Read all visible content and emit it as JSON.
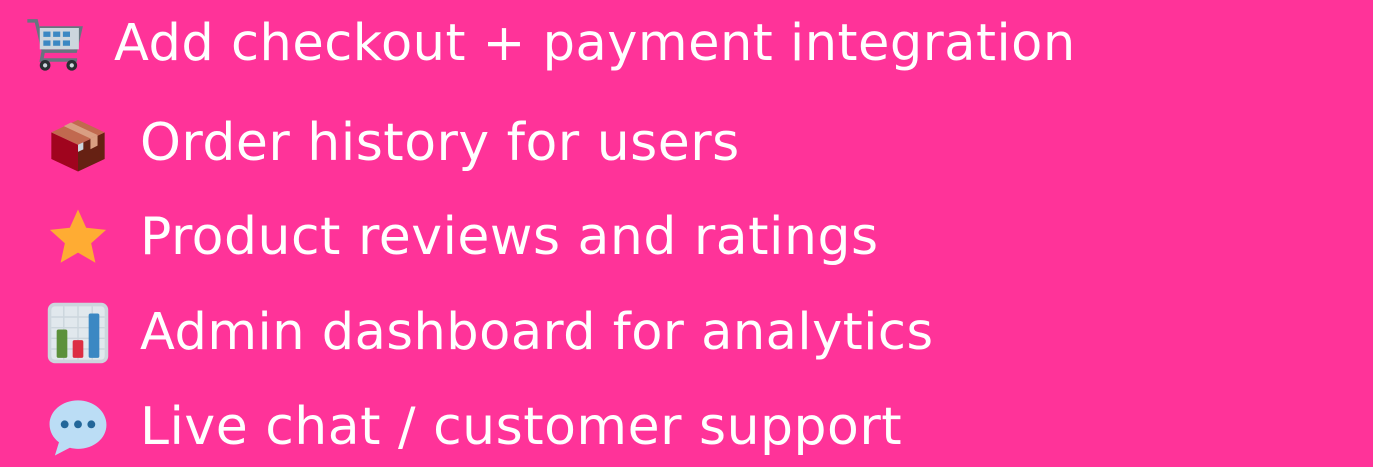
{
  "features": {
    "items": [
      {
        "icon": "shopping-cart-icon",
        "label": "Add checkout + payment integration"
      },
      {
        "icon": "package-icon",
        "label": "Order history for users"
      },
      {
        "icon": "star-icon",
        "label": "Product reviews and ratings"
      },
      {
        "icon": "bar-chart-icon",
        "label": "Admin dashboard for analytics"
      },
      {
        "icon": "speech-balloon-icon",
        "label": "Live chat / customer support"
      }
    ]
  },
  "colors": {
    "background": "#ff3399",
    "text": "#ffffff",
    "star": "#ffac33",
    "chart_green": "#5c913b",
    "chart_red": "#dd2e44",
    "chart_blue": "#3b88c3",
    "balloon": "#bbddf5",
    "balloon_dots": "#269"
  }
}
